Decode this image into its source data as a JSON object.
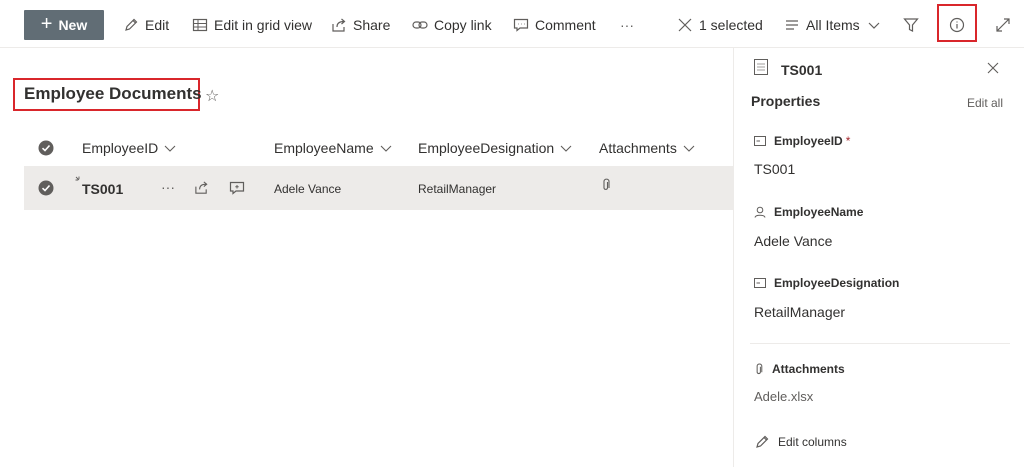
{
  "toolbar": {
    "new_label": "New",
    "edit_label": "Edit",
    "grid_label": "Edit in grid view",
    "share_label": "Share",
    "copy_link_label": "Copy link",
    "comment_label": "Comment",
    "more_label": "···",
    "selected_label": "1 selected",
    "view_label": "All Items"
  },
  "list": {
    "title": "Employee Documents",
    "columns": [
      "EmployeeID",
      "EmployeeName",
      "EmployeeDesignation",
      "Attachments"
    ],
    "rows": [
      {
        "id": "TS001",
        "name": "Adele Vance",
        "designation": "RetailManager",
        "more": "···"
      }
    ]
  },
  "details": {
    "title": "TS001",
    "properties_label": "Properties",
    "edit_all_label": "Edit all",
    "fields": [
      {
        "label": "EmployeeID",
        "required_mark": "*",
        "value": "TS001"
      },
      {
        "label": "EmployeeName",
        "value": "Adele Vance"
      },
      {
        "label": "EmployeeDesignation",
        "value": "RetailManager"
      }
    ],
    "attachments_label": "Attachments",
    "attachment_file": "Adele.xlsx",
    "edit_columns_label": "Edit columns"
  },
  "colors": {
    "new_button": "#616d75",
    "highlight_box": "#d9262b",
    "selected_row": "#edebe9"
  }
}
